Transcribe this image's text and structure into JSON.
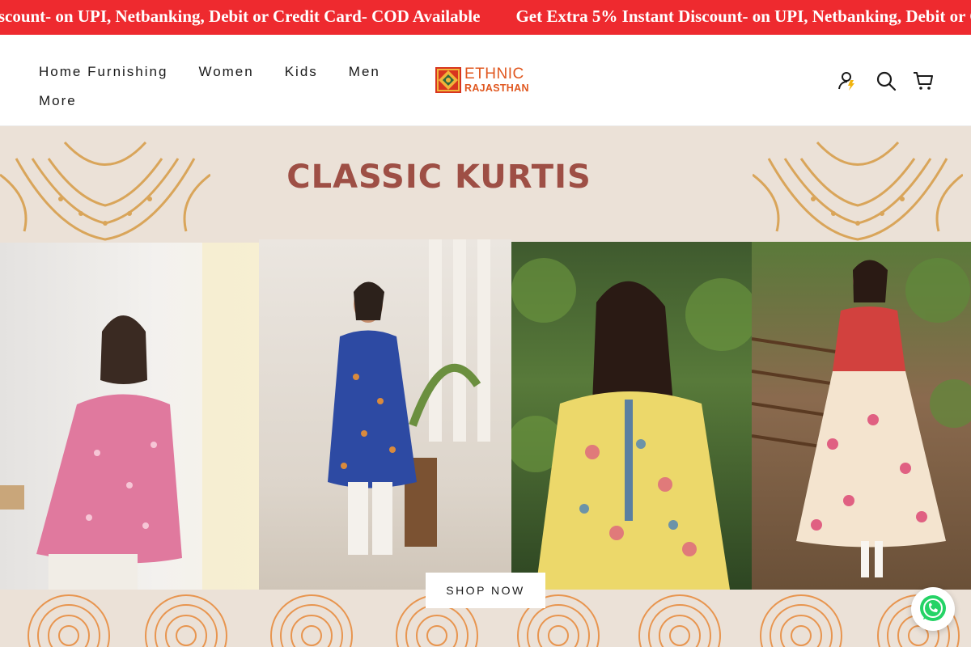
{
  "announcement": {
    "messages": [
      "Get Extra 5% Instant Discount- on UPI, Netbanking, Debit or Credit Card- COD Available",
      "Get Extra 5% Instant Discount- on UPI, Netbanking, Debit or Credit Card- COD Available"
    ],
    "visible_lead": "iscount- on UPI, Netbanking, Debit or Credit Card- COD Available",
    "visible_tail": "Get Extra 5% Instant Discount- on UPI, Netbanking, Debit or C",
    "background": "#ee2a2f"
  },
  "header": {
    "nav": [
      {
        "label": "Home Furnishing"
      },
      {
        "label": "Women"
      },
      {
        "label": "Kids"
      },
      {
        "label": "Men"
      },
      {
        "label": "More"
      }
    ],
    "logo": {
      "line1": "ETHNIC",
      "line2": "RAJASTHAN",
      "color": "#e0571f"
    },
    "icons": [
      "account-icon",
      "search-icon",
      "cart-icon"
    ]
  },
  "hero": {
    "title": "CLASSIC KURTIS",
    "title_color": "#9e4f45",
    "background": "#ebe1d7",
    "cta": "SHOP NOW",
    "photos": [
      {
        "name": "photo-pink-short-kurti"
      },
      {
        "name": "photo-blue-printed-kurta"
      },
      {
        "name": "photo-yellow-floral-kurti"
      },
      {
        "name": "photo-red-anarkali-kurta"
      }
    ]
  },
  "floating": {
    "icon": "whatsapp-icon",
    "color": "#25d366"
  }
}
